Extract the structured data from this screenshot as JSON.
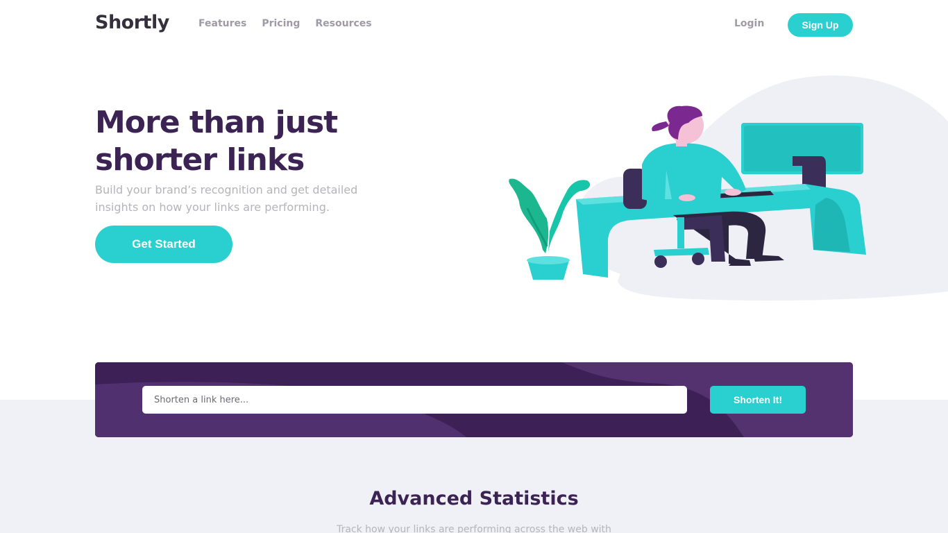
{
  "brand": {
    "name": "Shortly",
    "accent": "#2acfcf",
    "dark_violet": "#3b2354"
  },
  "nav": {
    "items": [
      "Features",
      "Pricing",
      "Resources"
    ],
    "login_label": "Login",
    "signup_label": "Sign Up"
  },
  "hero": {
    "title": "More than just shorter links",
    "subtitle": "Build your brand’s recognition and get detailed insights on how your links are performing.",
    "cta_label": "Get Started",
    "illustration": "person-working-illustration"
  },
  "shorten": {
    "placeholder": "Shorten a link here...",
    "button_label": "Shorten It!"
  },
  "stats": {
    "title": "Advanced Statistics",
    "subtitle": "Track how your links are performing across the web with"
  }
}
